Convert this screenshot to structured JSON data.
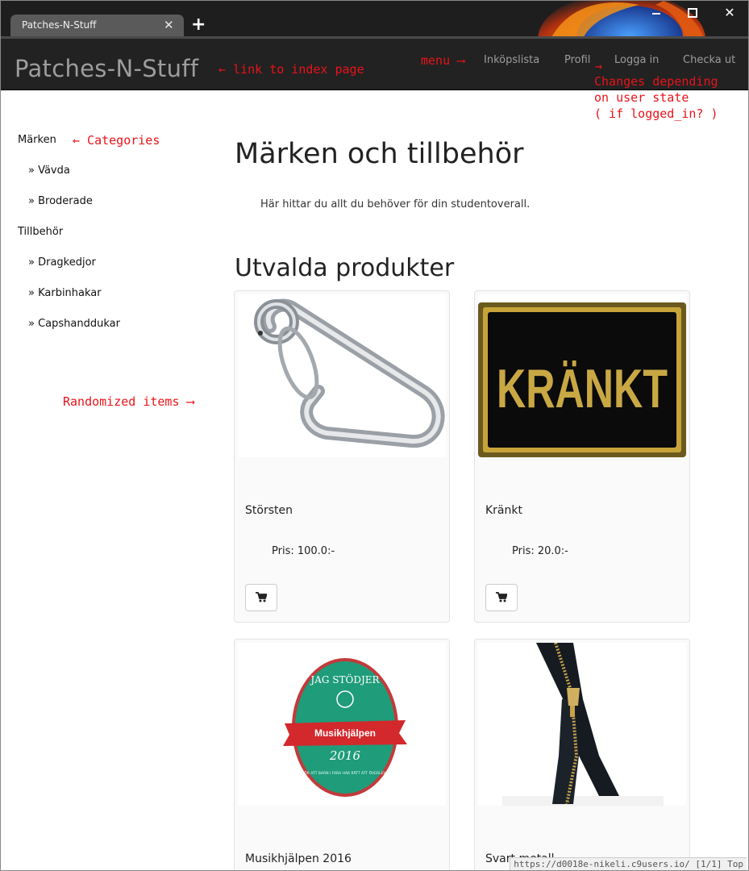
{
  "browser": {
    "tab_title": "Patches-N-Stuff",
    "tab_close": "✕",
    "new_tab": "+",
    "status_url": "https://d0018e-nikeli.c9users.io/",
    "status_page": "[1/1]",
    "status_pos": "Top"
  },
  "navbar": {
    "brand": "Patches-N-Stuff",
    "links": [
      "Inköpslista",
      "Profil",
      "Logga in",
      "Checka ut"
    ]
  },
  "annotations": {
    "index_link": "← link to index page",
    "menu": "menu ⟶",
    "user_state_arrow": "→",
    "user_state": "Changes depending\non user state\n( if logged_in? )",
    "categories": "← Categories",
    "randomized": "Randomized items ⟶"
  },
  "sidebar": {
    "groups": [
      {
        "label": "Märken",
        "items": [
          "» Vävda",
          "» Broderade"
        ]
      },
      {
        "label": "Tillbehör",
        "items": [
          "» Dragkedjor",
          "» Karbinhakar",
          "» Capshanddukar"
        ]
      }
    ]
  },
  "main": {
    "title": "Märken och tillbehör",
    "lead": "Här hittar du allt du behöver för din studentoverall.",
    "featured_title": "Utvalda produkter",
    "products": [
      {
        "name": "Störsten",
        "price": "Pris: 100.0:-"
      },
      {
        "name": "Kränkt",
        "price": "Pris: 20.0:-"
      },
      {
        "name": "Musikhjälpen 2016",
        "price": ""
      },
      {
        "name": "Svart metall",
        "price": ""
      }
    ],
    "patch_text": "KRÄNKT",
    "badge_top": "JAG STÖDJER",
    "badge_ribbon": "Musikhjälpen",
    "badge_year": "2016",
    "badge_bottom": "FÖR ATT BARN I FARA HAR RÄTT ATT ÖVERLEVA"
  }
}
